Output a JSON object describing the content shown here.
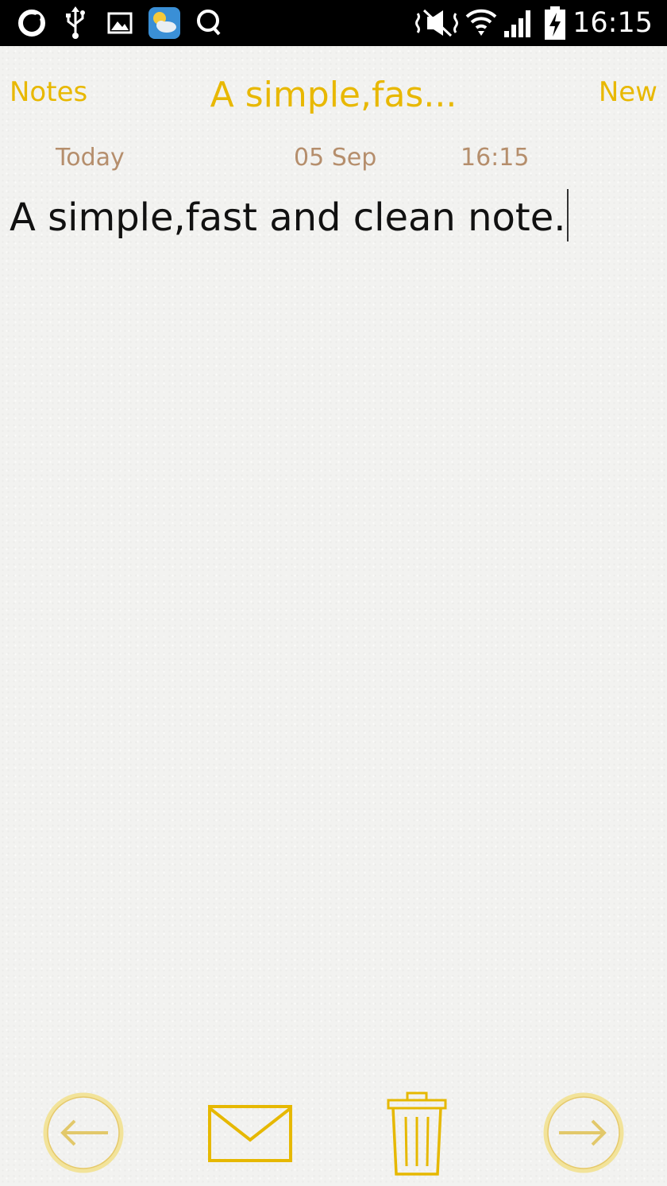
{
  "status_bar": {
    "icons": [
      "sync-icon",
      "usb-icon",
      "gallery-icon",
      "weather-icon",
      "search-icon",
      "mute-icon",
      "wifi-icon",
      "signal-icon",
      "battery-charging-icon"
    ],
    "time": "16:15"
  },
  "header": {
    "back_label": "Notes",
    "title": "A simple,fas...",
    "new_label": "New"
  },
  "note": {
    "date_label": "Today",
    "date": "05 Sep",
    "time": "16:15",
    "text": "A simple,fast and clean note."
  },
  "toolbar": {
    "icons": [
      "previous-icon",
      "mail-icon",
      "trash-icon",
      "next-icon"
    ]
  },
  "colors": {
    "accent": "#e8b800",
    "date_text": "#b58e6c",
    "body_text": "#111111",
    "status_bar": "#000000"
  }
}
